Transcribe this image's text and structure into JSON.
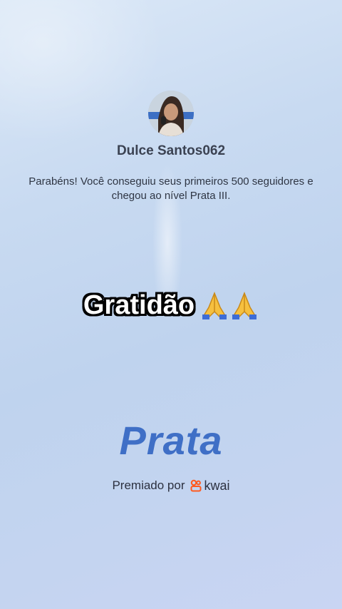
{
  "profile": {
    "username": "Dulce Santos062",
    "message": "Parabéns! Você conseguiu seus primeiros 500 seguidores e chegou ao nível Prata III."
  },
  "caption": {
    "text": "Gratidão",
    "emoji_icon": "praying-hands-icon"
  },
  "award": {
    "level": "Prata",
    "awarded_by_label": "Premiado por",
    "brand_name": "kwai",
    "brand_icon": "kwai-logo-icon"
  },
  "colors": {
    "level_text": "#3f6fc6",
    "kwai_orange": "#ff5a1f"
  }
}
